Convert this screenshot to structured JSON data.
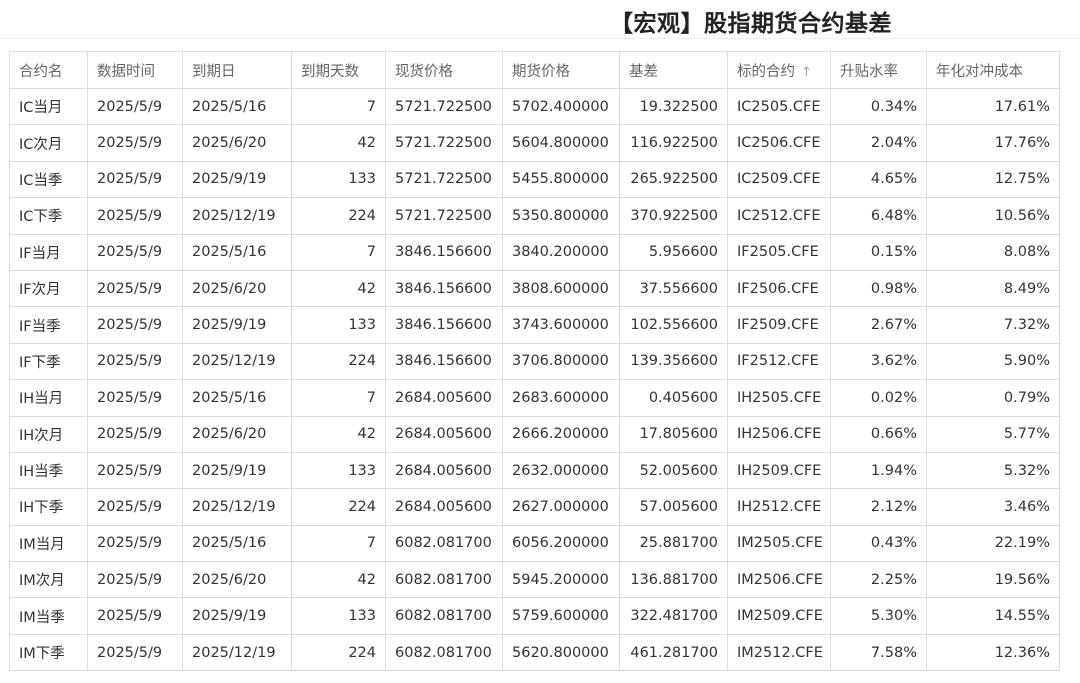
{
  "header": {
    "title": "【宏观】股指期货合约基差"
  },
  "table": {
    "columns": [
      {
        "key": "name",
        "label": "合约名",
        "align": "txt"
      },
      {
        "key": "date",
        "label": "数据时间",
        "align": "txt"
      },
      {
        "key": "expiry",
        "label": "到期日",
        "align": "txt"
      },
      {
        "key": "days",
        "label": "到期天数",
        "align": "num"
      },
      {
        "key": "spot",
        "label": "现货价格",
        "align": "txt"
      },
      {
        "key": "futures",
        "label": "期货价格",
        "align": "txt"
      },
      {
        "key": "basis",
        "label": "基差",
        "align": "num"
      },
      {
        "key": "code",
        "label": "标的合约",
        "align": "txt",
        "sort_icon": "arrow-up-icon"
      },
      {
        "key": "rate",
        "label": "升贴水率",
        "align": "num"
      },
      {
        "key": "cost",
        "label": "年化对冲成本",
        "align": "num"
      }
    ],
    "rows": [
      {
        "name": "IC当月",
        "date": "2025/5/9",
        "expiry": "2025/5/16",
        "days": "7",
        "spot": "5721.722500",
        "futures": "5702.400000",
        "basis": "19.322500",
        "code": "IC2505.CFE",
        "rate": "0.34%",
        "cost": "17.61%"
      },
      {
        "name": "IC次月",
        "date": "2025/5/9",
        "expiry": "2025/6/20",
        "days": "42",
        "spot": "5721.722500",
        "futures": "5604.800000",
        "basis": "116.922500",
        "code": "IC2506.CFE",
        "rate": "2.04%",
        "cost": "17.76%"
      },
      {
        "name": "IC当季",
        "date": "2025/5/9",
        "expiry": "2025/9/19",
        "days": "133",
        "spot": "5721.722500",
        "futures": "5455.800000",
        "basis": "265.922500",
        "code": "IC2509.CFE",
        "rate": "4.65%",
        "cost": "12.75%"
      },
      {
        "name": "IC下季",
        "date": "2025/5/9",
        "expiry": "2025/12/19",
        "days": "224",
        "spot": "5721.722500",
        "futures": "5350.800000",
        "basis": "370.922500",
        "code": "IC2512.CFE",
        "rate": "6.48%",
        "cost": "10.56%"
      },
      {
        "name": "IF当月",
        "date": "2025/5/9",
        "expiry": "2025/5/16",
        "days": "7",
        "spot": "3846.156600",
        "futures": "3840.200000",
        "basis": "5.956600",
        "code": "IF2505.CFE",
        "rate": "0.15%",
        "cost": "8.08%"
      },
      {
        "name": "IF次月",
        "date": "2025/5/9",
        "expiry": "2025/6/20",
        "days": "42",
        "spot": "3846.156600",
        "futures": "3808.600000",
        "basis": "37.556600",
        "code": "IF2506.CFE",
        "rate": "0.98%",
        "cost": "8.49%"
      },
      {
        "name": "IF当季",
        "date": "2025/5/9",
        "expiry": "2025/9/19",
        "days": "133",
        "spot": "3846.156600",
        "futures": "3743.600000",
        "basis": "102.556600",
        "code": "IF2509.CFE",
        "rate": "2.67%",
        "cost": "7.32%"
      },
      {
        "name": "IF下季",
        "date": "2025/5/9",
        "expiry": "2025/12/19",
        "days": "224",
        "spot": "3846.156600",
        "futures": "3706.800000",
        "basis": "139.356600",
        "code": "IF2512.CFE",
        "rate": "3.62%",
        "cost": "5.90%"
      },
      {
        "name": "IH当月",
        "date": "2025/5/9",
        "expiry": "2025/5/16",
        "days": "7",
        "spot": "2684.005600",
        "futures": "2683.600000",
        "basis": "0.405600",
        "code": "IH2505.CFE",
        "rate": "0.02%",
        "cost": "0.79%"
      },
      {
        "name": "IH次月",
        "date": "2025/5/9",
        "expiry": "2025/6/20",
        "days": "42",
        "spot": "2684.005600",
        "futures": "2666.200000",
        "basis": "17.805600",
        "code": "IH2506.CFE",
        "rate": "0.66%",
        "cost": "5.77%"
      },
      {
        "name": "IH当季",
        "date": "2025/5/9",
        "expiry": "2025/9/19",
        "days": "133",
        "spot": "2684.005600",
        "futures": "2632.000000",
        "basis": "52.005600",
        "code": "IH2509.CFE",
        "rate": "1.94%",
        "cost": "5.32%"
      },
      {
        "name": "IH下季",
        "date": "2025/5/9",
        "expiry": "2025/12/19",
        "days": "224",
        "spot": "2684.005600",
        "futures": "2627.000000",
        "basis": "57.005600",
        "code": "IH2512.CFE",
        "rate": "2.12%",
        "cost": "3.46%"
      },
      {
        "name": "IM当月",
        "date": "2025/5/9",
        "expiry": "2025/5/16",
        "days": "7",
        "spot": "6082.081700",
        "futures": "6056.200000",
        "basis": "25.881700",
        "code": "IM2505.CFE",
        "rate": "0.43%",
        "cost": "22.19%"
      },
      {
        "name": "IM次月",
        "date": "2025/5/9",
        "expiry": "2025/6/20",
        "days": "42",
        "spot": "6082.081700",
        "futures": "5945.200000",
        "basis": "136.881700",
        "code": "IM2506.CFE",
        "rate": "2.25%",
        "cost": "19.56%"
      },
      {
        "name": "IM当季",
        "date": "2025/5/9",
        "expiry": "2025/9/19",
        "days": "133",
        "spot": "6082.081700",
        "futures": "5759.600000",
        "basis": "322.481700",
        "code": "IM2509.CFE",
        "rate": "5.30%",
        "cost": "14.55%"
      },
      {
        "name": "IM下季",
        "date": "2025/5/9",
        "expiry": "2025/12/19",
        "days": "224",
        "spot": "6082.081700",
        "futures": "5620.800000",
        "basis": "461.281700",
        "code": "IM2512.CFE",
        "rate": "7.58%",
        "cost": "12.36%"
      }
    ]
  }
}
